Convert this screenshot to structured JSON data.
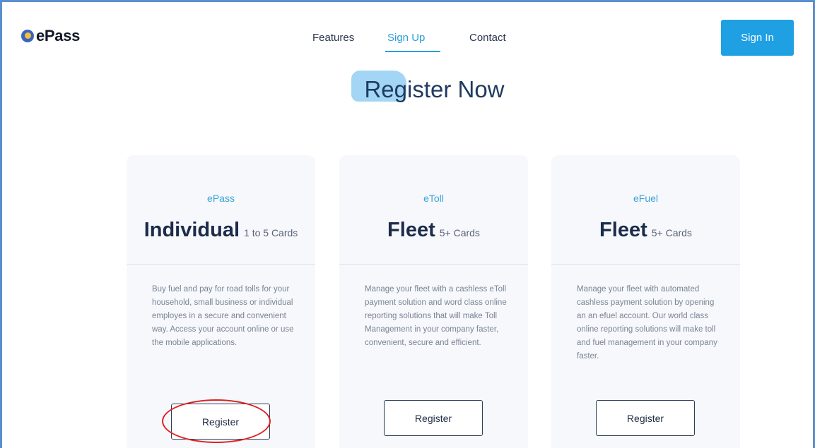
{
  "header": {
    "logo_text": "ePass",
    "nav": [
      {
        "label": "Features"
      },
      {
        "label": "Sign Up"
      },
      {
        "label": "Contact"
      }
    ],
    "signin_label": "Sign In"
  },
  "page": {
    "title": "Register Now"
  },
  "cards": [
    {
      "tag": "ePass",
      "title": "Individual",
      "subtitle": "1 to 5 Cards",
      "description": "Buy fuel and pay for road tolls for your household, small business or individual employes in a secure and convenient way. Access your account online or use the mobile applications.",
      "button_label": "Register"
    },
    {
      "tag": "eToll",
      "title": "Fleet",
      "subtitle": "5+ Cards",
      "description": "Manage your fleet with a cashless eToll payment solution and word class online reporting solutions that will make Toll Management in your company faster, convenient, secure and efficient.",
      "button_label": "Register"
    },
    {
      "tag": "eFuel",
      "title": "Fleet",
      "subtitle": "5+ Cards",
      "description": "Manage your fleet with automated cashless payment solution by opening an an efuel account. Our world class online reporting solutions will make toll and fuel management in your company faster.",
      "button_label": "Register"
    }
  ],
  "colors": {
    "accent": "#2a9fd6",
    "signin_bg": "#1fa0e3",
    "heading_highlight": "#a3d5f5",
    "annotation": "#e02020"
  }
}
